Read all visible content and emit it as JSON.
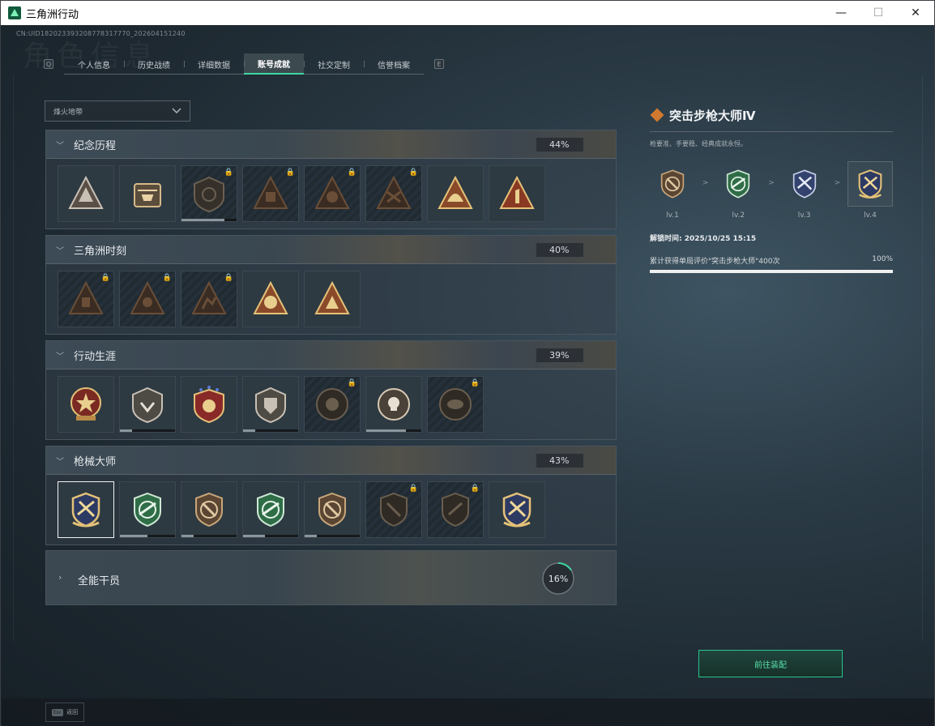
{
  "window": {
    "title": "三角洲行动",
    "minimize": "—",
    "maximize": "☐",
    "close": "✕"
  },
  "header": {
    "uid": "CN:UID182023393208778317770_202604151240",
    "bg_title": "角色信息"
  },
  "tabs": {
    "left_key": "Q",
    "right_key": "E",
    "items": [
      "个人信息",
      "历史战绩",
      "详细数据",
      "账号成就",
      "社交定制",
      "信誉档案"
    ],
    "active": 3
  },
  "filter": {
    "value": "烽火地带"
  },
  "sections": [
    {
      "name": "纪念历程",
      "percent": "44%"
    },
    {
      "name": "三角洲时刻",
      "percent": "40%"
    },
    {
      "name": "行动生涯",
      "percent": "39%"
    },
    {
      "name": "枪械大师",
      "percent": "43%"
    },
    {
      "name": "全能干员",
      "percent": "16%",
      "progress": 0.16
    }
  ],
  "detail": {
    "title": "突击步枪大师Ⅳ",
    "description": "枪要准、手要稳、经典成就永恒。",
    "levels": [
      "lv.1",
      "lv.2",
      "lv.3",
      "lv.4"
    ],
    "unlock_time": "解锁时间: 2025/10/25 15:15",
    "progress_label": "累计获得单局评价\"突击步枪大师\"400次",
    "progress_percent": "100%",
    "progress": 1.0
  },
  "actions": {
    "go_equip": "前往装配"
  },
  "footer": {
    "esc_key": "Esc",
    "back": "返回"
  },
  "colors": {
    "accent": "#3ed7a2",
    "gold": "#c9a24d",
    "bronze": "#8a6a45",
    "green": "#2f6d47",
    "blue": "#34436e"
  }
}
